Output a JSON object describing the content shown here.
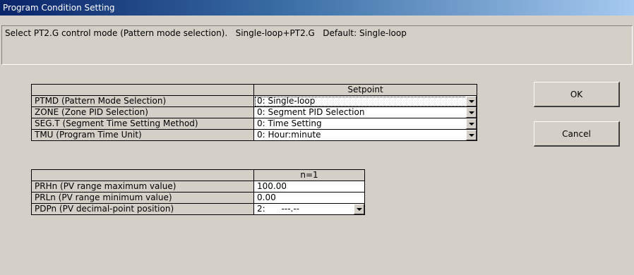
{
  "window": {
    "title": "Program Condition Setting"
  },
  "description": "Select PT2.G control mode (Pattern mode selection).   Single-loop+PT2.G   Default: Single-loop",
  "table1": {
    "header": "Setpoint",
    "rows": [
      {
        "label": "PTMD (Pattern Mode Selection)",
        "value": "0: Single-loop"
      },
      {
        "label": "ZONE (Zone PID Selection)",
        "value": "0: Segment PID Selection"
      },
      {
        "label": "SEG.T (Segment Time Setting Method)",
        "value": "0: Time Setting"
      },
      {
        "label": "TMU (Program Time Unit)",
        "value": "0: Hour:minute"
      }
    ]
  },
  "table2": {
    "header": "n=1",
    "rows": [
      {
        "label": "PRHn (PV range maximum value)",
        "value": "100.00"
      },
      {
        "label": "PRLn (PV range minimum value)",
        "value": "0.00"
      },
      {
        "label": "PDPn (PV decimal-point position)",
        "value": "2:      ---.--"
      }
    ]
  },
  "buttons": {
    "ok": "OK",
    "cancel": "Cancel"
  },
  "icons": {
    "dropdown": "chevron-down-icon"
  }
}
